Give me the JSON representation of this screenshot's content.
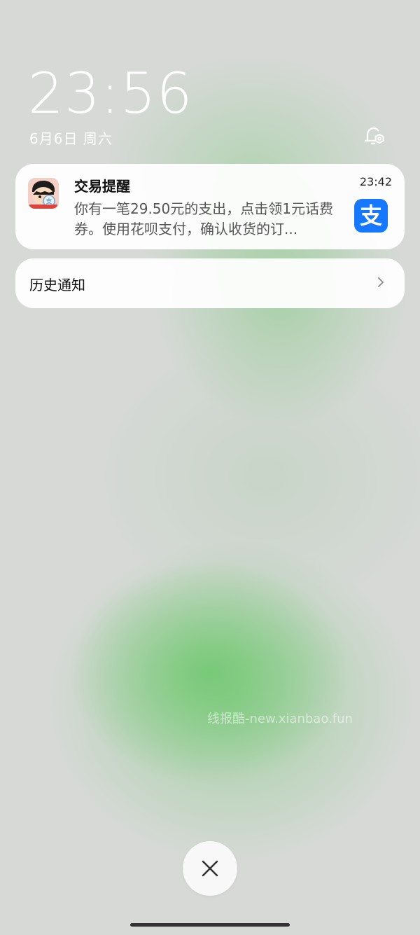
{
  "lockscreen": {
    "time": "23:56",
    "date": "6月6日 周六"
  },
  "notification": {
    "title": "交易提醒",
    "time": "23:42",
    "body": "你有一笔29.50元的支出，点击领1元话费券。使用花呗支付，确认收货的订...",
    "app_icon": "avatar-cartoon-icon",
    "badge_icon": "alipay-icon",
    "badge_text": "支",
    "badge_color": "#1677ff"
  },
  "history": {
    "label": "历史通知"
  },
  "watermark": "线报酷-new.xianbao.fun",
  "icons": {
    "settings": "notification-settings-icon",
    "close": "close-icon",
    "chevron": "chevron-right-icon"
  }
}
